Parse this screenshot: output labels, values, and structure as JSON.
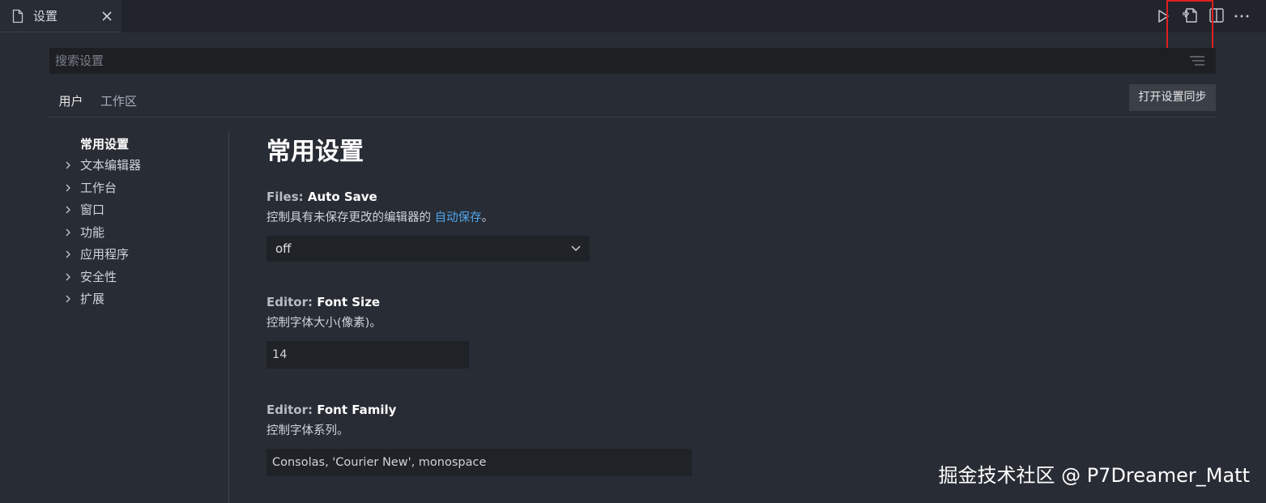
{
  "tab": {
    "label": "设置"
  },
  "search": {
    "placeholder": "搜索设置"
  },
  "scope_tabs": {
    "user": "用户",
    "workspace": "工作区"
  },
  "sync_button": "打开设置同步",
  "toc": {
    "items": [
      {
        "label": "常用设置",
        "expandable": false,
        "active": true
      },
      {
        "label": "文本编辑器",
        "expandable": true
      },
      {
        "label": "工作台",
        "expandable": true
      },
      {
        "label": "窗口",
        "expandable": true
      },
      {
        "label": "功能",
        "expandable": true
      },
      {
        "label": "应用程序",
        "expandable": true
      },
      {
        "label": "安全性",
        "expandable": true
      },
      {
        "label": "扩展",
        "expandable": true
      }
    ]
  },
  "main": {
    "title": "常用设置",
    "settings": [
      {
        "category": "Files: ",
        "name": "Auto Save",
        "desc_before": "控制具有未保存更改的编辑器的 ",
        "desc_link": "自动保存",
        "desc_after": "。",
        "value": "off"
      },
      {
        "category": "Editor: ",
        "name": "Font Size",
        "desc": "控制字体大小(像素)。",
        "value": "14"
      },
      {
        "category": "Editor: ",
        "name": "Font Family",
        "desc": "控制字体系列。",
        "value": "Consolas, 'Courier New', monospace"
      }
    ]
  },
  "watermark": "掘金技术社区 @ P7Dreamer_Matt",
  "icons": {
    "tab": "file-icon",
    "close": "close-icon",
    "run": "run-icon",
    "open_json": "open-settings-json-icon",
    "split": "split-editor-icon",
    "more": "more-actions-icon",
    "filter": "filter-icon"
  },
  "colors": {
    "background": "#282c34",
    "tabbar": "#21252b",
    "link": "#4fa6ed",
    "highlight": "#e0201f"
  }
}
